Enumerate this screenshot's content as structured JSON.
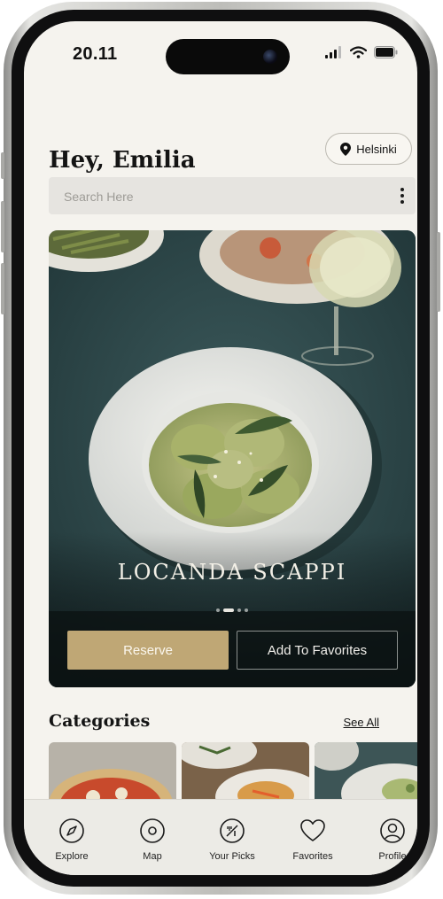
{
  "status_bar": {
    "time": "20.11"
  },
  "header": {
    "greeting": "Hey, Emilia",
    "location": "Helsinki"
  },
  "search": {
    "placeholder": "Search Here"
  },
  "hero": {
    "restaurant_name": "LOCANDA SCAPPI",
    "carousel": {
      "total": 4,
      "active": 1
    },
    "reserve_label": "Reserve",
    "favorite_label": "Add To Favorites"
  },
  "categories": {
    "title": "Categories",
    "see_all": "See All"
  },
  "nav": {
    "items": [
      {
        "label": "Explore",
        "icon": "compass-icon"
      },
      {
        "label": "Map",
        "icon": "map-pin-icon"
      },
      {
        "label": "Your Picks",
        "icon": "picks-icon"
      },
      {
        "label": "Favorites",
        "icon": "heart-icon"
      },
      {
        "label": "Profile",
        "icon": "profile-icon"
      }
    ]
  },
  "colors": {
    "accent": "#bfa775",
    "background": "#f5f3ee",
    "hero_bg": "#2f4a4c",
    "text": "#141414"
  }
}
